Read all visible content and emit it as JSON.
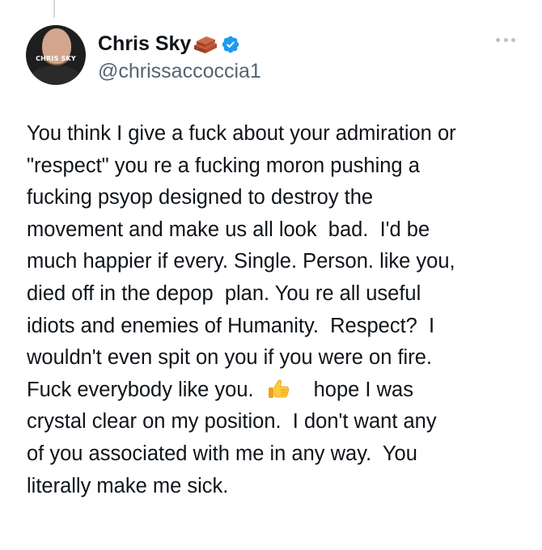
{
  "author": {
    "display_name": "Chris Sky",
    "handle": "@chrissaccoccia1",
    "avatar_text": "CHRIS SKY",
    "name_emoji": "brick-icon",
    "verified": true,
    "verified_color": "#1d9bf0"
  },
  "menu": {
    "icon": "more-options-icon"
  },
  "tweet": {
    "lines": [
      "You think I give a fuck about your admiration or",
      "\"respect\" you re a fucking moron pushing a",
      "fucking psyop designed to destroy the",
      "movement and make us all look  bad.  I'd be",
      "much happier if every. Single. Person. like you,",
      "died off in the depop  plan. You re all useful",
      "idiots and enemies of Humanity.  Respect?  I",
      "wouldn't even spit on you if you were on fire.",
      "Fuck everybody like you.",
      "hope I was",
      "crystal clear on my position.  I don't want any",
      "of you associated with me in any way.  You",
      "literally make me sick."
    ],
    "inline_emoji": "thumbs-up-icon"
  },
  "colors": {
    "text": "#0f1419",
    "secondary": "#536471",
    "thread_line": "#cfd9de"
  }
}
